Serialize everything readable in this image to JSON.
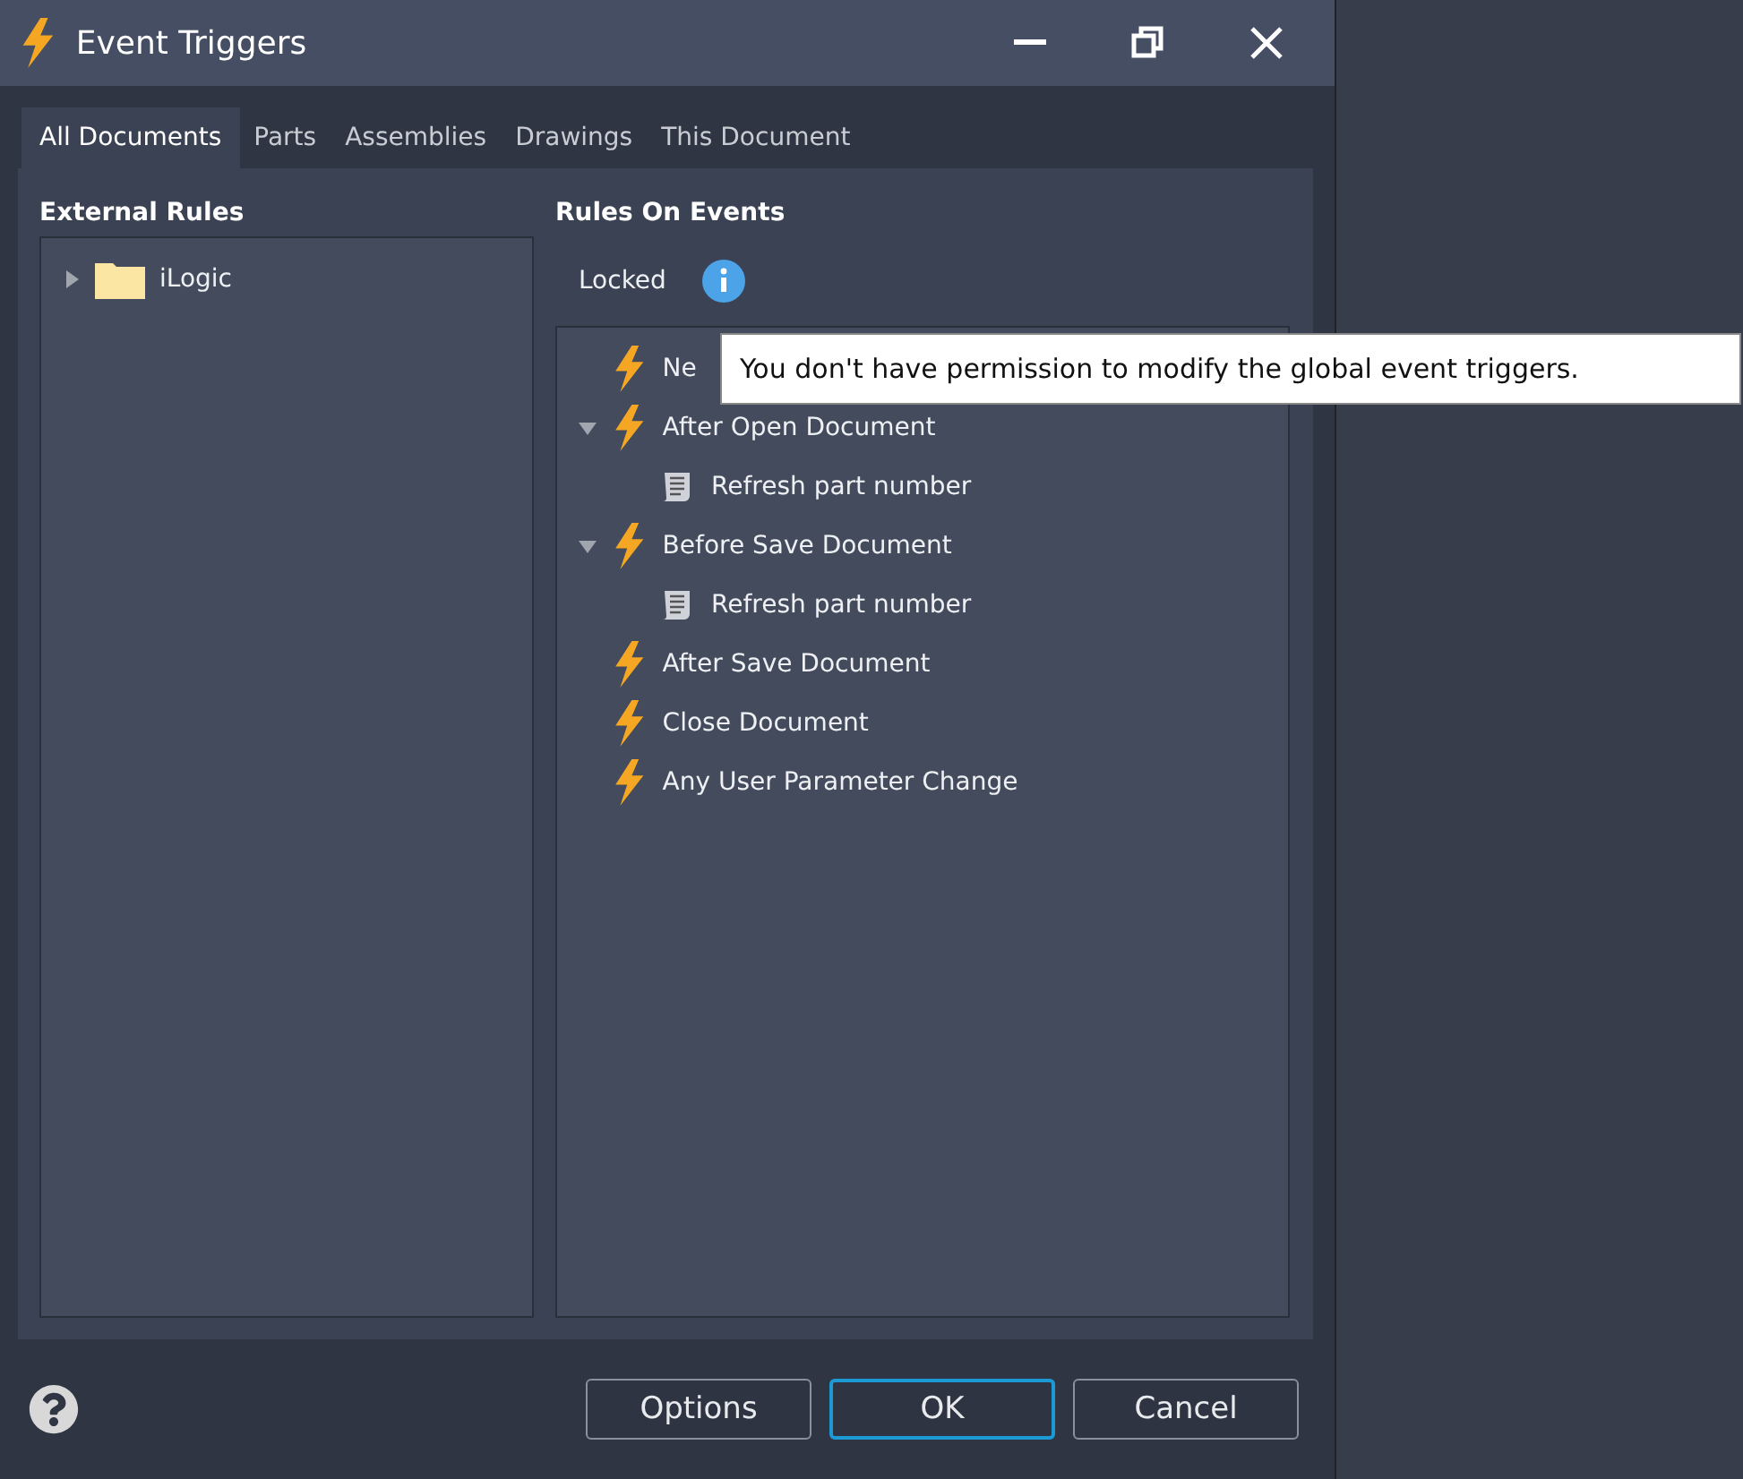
{
  "window": {
    "title": "Event Triggers"
  },
  "tabs": [
    {
      "label": "All Documents",
      "selected": true
    },
    {
      "label": "Parts",
      "selected": false
    },
    {
      "label": "Assemblies",
      "selected": false
    },
    {
      "label": "Drawings",
      "selected": false
    },
    {
      "label": "This Document",
      "selected": false
    }
  ],
  "external_rules": {
    "heading": "External Rules",
    "items": [
      {
        "label": "iLogic",
        "expanded": false
      }
    ]
  },
  "rules_on_events": {
    "heading": "Rules On Events",
    "status": "Locked",
    "tooltip": "You don't have permission to modify the global event triggers.",
    "events": [
      {
        "label": "Ne"
      },
      {
        "label": "After Open Document",
        "expanded": true,
        "children": [
          {
            "label": "Refresh part number"
          }
        ]
      },
      {
        "label": "Before Save Document",
        "expanded": true,
        "children": [
          {
            "label": "Refresh part number"
          }
        ]
      },
      {
        "label": "After Save Document"
      },
      {
        "label": "Close Document"
      },
      {
        "label": "Any User Parameter Change"
      }
    ]
  },
  "buttons": [
    {
      "label": "Options",
      "selected": false
    },
    {
      "label": "OK",
      "selected": true
    },
    {
      "label": "Cancel",
      "selected": false
    }
  ]
}
